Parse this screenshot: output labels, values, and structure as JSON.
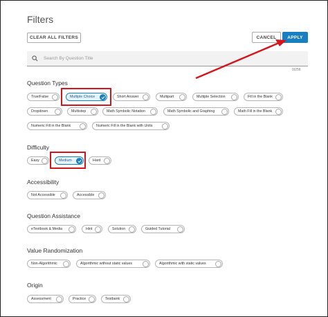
{
  "title": "Filters",
  "buttons": {
    "clear": "CLEAR ALL FILTERS",
    "cancel": "CANCEL",
    "apply": "APPLY"
  },
  "search": {
    "placeholder": "Search By Question Title",
    "counter": "0/256"
  },
  "sections": {
    "question_types": {
      "label": "Question Types",
      "chips": [
        "True/False",
        "Multiple Choice",
        "Short Answer",
        "Multipart",
        "Multiple Selection",
        "Fill in the Blank",
        "Dropdown",
        "Multistep",
        "Math Symbolic Notation",
        "Math Symbolic and Graphing",
        "Math Fill in the Blank",
        "Numeric Fill in the Blank",
        "Numeric Fill in the Blank with Units"
      ],
      "selected": "Multiple Choice"
    },
    "difficulty": {
      "label": "Difficulty",
      "chips": [
        "Easy",
        "Medium",
        "Hard"
      ],
      "selected": "Medium"
    },
    "accessibility": {
      "label": "Accessibility",
      "chips": [
        "Not Accessible",
        "Accessible"
      ]
    },
    "question_assistance": {
      "label": "Question Assistance",
      "chips": [
        "eTextbook & Media",
        "Hint",
        "Solution",
        "Guided Tutorial"
      ]
    },
    "value_randomization": {
      "label": "Value Randomization",
      "chips": [
        "Non-Algorithmic",
        "Algorithmic without static values",
        "Algorithmic with static values"
      ]
    },
    "origin": {
      "label": "Origin",
      "chips": [
        "Assessment",
        "Practice",
        "Testbank"
      ]
    }
  },
  "colors": {
    "accent": "#1a7fc1",
    "annotation": "#d4161c"
  }
}
